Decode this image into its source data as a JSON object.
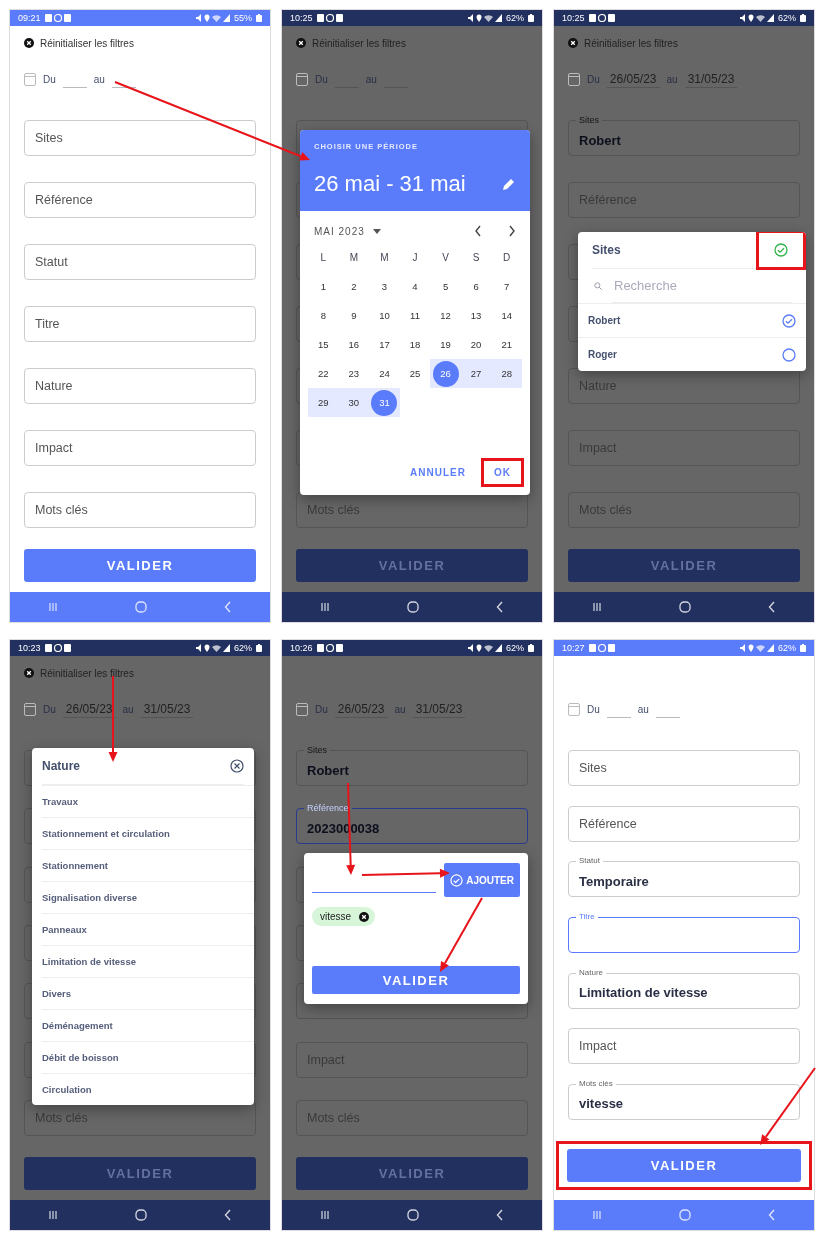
{
  "screens": [
    {
      "status_time": "09:21",
      "battery": "55%",
      "dimmed": false,
      "reset_label": "Réinitialiser les filtres",
      "date_range": {
        "from_label": "Du",
        "to_label": "au"
      },
      "fields": [
        {
          "kind": "field",
          "label": "Sites",
          "focused": false
        },
        {
          "kind": "field",
          "label": "Référence",
          "focused": false
        },
        {
          "kind": "field",
          "label": "Statut",
          "focused": false
        },
        {
          "kind": "field",
          "label": "Titre",
          "focused": false
        },
        {
          "kind": "field",
          "label": "Nature",
          "focused": false
        },
        {
          "kind": "field",
          "label": "Impact",
          "focused": false
        },
        {
          "kind": "field",
          "label": "Mots clés",
          "focused": false
        }
      ],
      "submit": {
        "label": "VALIDER",
        "highlighted": false
      }
    },
    {
      "status_time": "10:25",
      "battery": "62%",
      "dimmed": true,
      "reset_label": "Réinitialiser les filtres",
      "date_range": {
        "from_label": "Du",
        "to_label": "au"
      },
      "fields": [
        {
          "kind": "covered"
        },
        {
          "kind": "covered"
        },
        {
          "kind": "covered"
        },
        {
          "kind": "covered"
        },
        {
          "kind": "covered"
        },
        {
          "kind": "covered"
        },
        {
          "kind": "field",
          "label": "Mots clés",
          "focused": false
        }
      ],
      "submit": {
        "label": "VALIDER",
        "highlighted": false
      },
      "dialog": {
        "kind": "date_picker",
        "title": "CHOISIR UNE PÉRIODE",
        "range": "26 mai - 31 mai",
        "month": "MAI 2023",
        "weekdays": [
          "L",
          "M",
          "M",
          "J",
          "V",
          "S",
          "D"
        ],
        "days": [
          {
            "label": "1",
            "selected": false,
            "in_range": false
          },
          {
            "label": "2",
            "selected": false,
            "in_range": false
          },
          {
            "label": "3",
            "selected": false,
            "in_range": false
          },
          {
            "label": "4",
            "selected": false,
            "in_range": false
          },
          {
            "label": "5",
            "selected": false,
            "in_range": false
          },
          {
            "label": "6",
            "selected": false,
            "in_range": false
          },
          {
            "label": "7",
            "selected": false,
            "in_range": false
          },
          {
            "label": "8",
            "selected": false,
            "in_range": false
          },
          {
            "label": "9",
            "selected": false,
            "in_range": false
          },
          {
            "label": "10",
            "selected": false,
            "in_range": false
          },
          {
            "label": "11",
            "selected": false,
            "in_range": false
          },
          {
            "label": "12",
            "selected": false,
            "in_range": false
          },
          {
            "label": "13",
            "selected": false,
            "in_range": false
          },
          {
            "label": "14",
            "selected": false,
            "in_range": false
          },
          {
            "label": "15",
            "selected": false,
            "in_range": false
          },
          {
            "label": "16",
            "selected": false,
            "in_range": false
          },
          {
            "label": "17",
            "selected": false,
            "in_range": false
          },
          {
            "label": "18",
            "selected": false,
            "in_range": false
          },
          {
            "label": "19",
            "selected": false,
            "in_range": false
          },
          {
            "label": "20",
            "selected": false,
            "in_range": false
          },
          {
            "label": "21",
            "selected": false,
            "in_range": false
          },
          {
            "label": "22",
            "selected": false,
            "in_range": false
          },
          {
            "label": "23",
            "selected": false,
            "in_range": false
          },
          {
            "label": "24",
            "selected": false,
            "in_range": false
          },
          {
            "label": "25",
            "selected": false,
            "in_range": false
          },
          {
            "label": "26",
            "selected": true,
            "in_range": true
          },
          {
            "label": "27",
            "selected": false,
            "in_range": true
          },
          {
            "label": "28",
            "selected": false,
            "in_range": true
          },
          {
            "label": "29",
            "selected": false,
            "in_range": true
          },
          {
            "label": "30",
            "selected": false,
            "in_range": true
          },
          {
            "label": "31",
            "selected": true,
            "in_range": true
          }
        ],
        "buttons": [
          {
            "label": "ANNULER",
            "highlighted": false
          },
          {
            "label": "OK",
            "highlighted": true
          }
        ]
      }
    },
    {
      "status_time": "10:25",
      "battery": "62%",
      "dimmed": true,
      "reset_label": "Réinitialiser les filtres",
      "date_range": {
        "from_label": "Du",
        "from": "26/05/23",
        "to_label": "au",
        "to": "31/05/23"
      },
      "fields": [
        {
          "kind": "field",
          "label": "Sites",
          "value": "Robert",
          "focused": false
        },
        {
          "kind": "field",
          "label": "Référence",
          "focused": false
        },
        {
          "kind": "covered"
        },
        {
          "kind": "covered"
        },
        {
          "kind": "field",
          "label": "Nature",
          "focused": false
        },
        {
          "kind": "field",
          "label": "Impact",
          "focused": false
        },
        {
          "kind": "field",
          "label": "Mots clés",
          "focused": false
        }
      ],
      "submit": {
        "label": "VALIDER",
        "highlighted": false
      },
      "dialog": {
        "kind": "select",
        "title": "Sites",
        "confirm_highlighted": true,
        "search_placeholder": "Recherche",
        "options": [
          {
            "label": "Robert",
            "selected": true
          },
          {
            "label": "Roger",
            "selected": false
          }
        ]
      }
    },
    {
      "status_time": "10:23",
      "battery": "62%",
      "dimmed": true,
      "reset_label": "Réinitialiser les filtres",
      "date_range": {
        "from_label": "Du",
        "from": "26/05/23",
        "to_label": "au",
        "to": "31/05/23"
      },
      "fields": [
        {
          "kind": "covered"
        },
        {
          "kind": "covered"
        },
        {
          "kind": "covered"
        },
        {
          "kind": "covered"
        },
        {
          "kind": "covered"
        },
        {
          "kind": "covered"
        },
        {
          "kind": "field",
          "label": "Mots clés",
          "focused": false
        }
      ],
      "submit": {
        "label": "VALIDER",
        "highlighted": false
      },
      "dialog": {
        "kind": "list",
        "title": "Nature",
        "items": [
          "Travaux",
          "Stationnement et circulation",
          "Stationnement",
          "Signalisation diverse",
          "Panneaux",
          "Limitation de vitesse",
          "Divers",
          "Déménagement",
          "Débit de boisson",
          "Circulation"
        ]
      }
    },
    {
      "status_time": "10:26",
      "battery": "62%",
      "dimmed": true,
      "date_range": {
        "from_label": "Du",
        "from": "26/05/23",
        "to_label": "au",
        "to": "31/05/23"
      },
      "fields": [
        {
          "kind": "field",
          "label": "Sites",
          "value": "Robert",
          "focused": false
        },
        {
          "kind": "field",
          "label": "Référence",
          "value": "2023000038",
          "focused": true
        },
        {
          "kind": "covered"
        },
        {
          "kind": "covered"
        },
        {
          "kind": "covered"
        },
        {
          "kind": "field",
          "label": "Impact",
          "focused": false
        },
        {
          "kind": "field",
          "label": "Mots clés",
          "focused": false
        }
      ],
      "submit": {
        "label": "VALIDER",
        "highlighted": false
      },
      "dialog": {
        "kind": "tags",
        "add_label": "AJOUTER",
        "chips": [
          "vitesse"
        ],
        "submit_label": "VALIDER"
      }
    },
    {
      "status_time": "10:27",
      "battery": "62%",
      "dimmed": false,
      "date_range": {
        "from_label": "Du",
        "to_label": "au"
      },
      "fields": [
        {
          "kind": "field",
          "label": "Sites",
          "focused": false
        },
        {
          "kind": "field",
          "label": "Référence",
          "focused": false
        },
        {
          "kind": "field",
          "label": "Statut",
          "value": "Temporaire",
          "focused": false
        },
        {
          "kind": "field",
          "label": "Titre",
          "focused": true
        },
        {
          "kind": "field",
          "label": "Nature",
          "value": "Limitation de vitesse",
          "focused": false
        },
        {
          "kind": "field",
          "label": "Impact",
          "focused": false
        },
        {
          "kind": "field",
          "label": "Mots clés",
          "value": "vitesse",
          "focused": false
        }
      ],
      "submit": {
        "label": "VALIDER",
        "highlighted": true
      }
    }
  ]
}
